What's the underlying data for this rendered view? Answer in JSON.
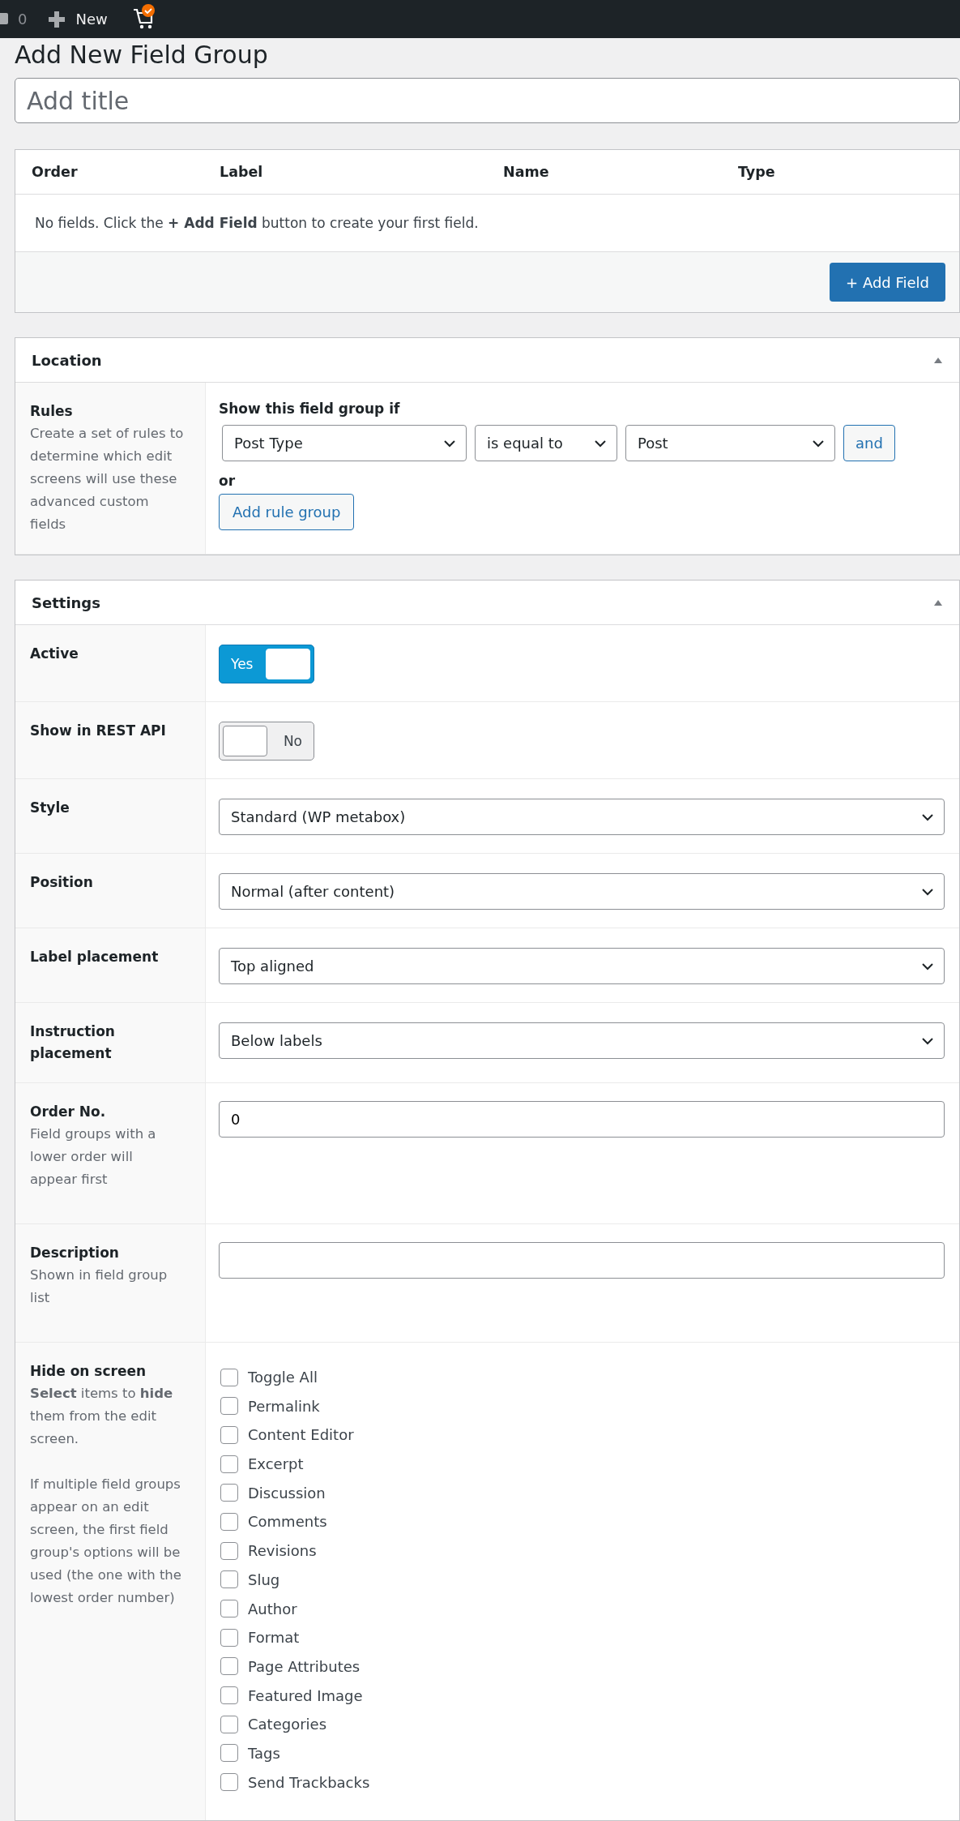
{
  "admin_bar": {
    "comments_count": "0",
    "new_label": "New"
  },
  "page_title": "Add New Field Group",
  "title_field": {
    "placeholder": "Add title"
  },
  "fields_table": {
    "columns": [
      "Order",
      "Label",
      "Name",
      "Type"
    ],
    "empty_message": "No fields. Click the **+ Add Field** button to create your first field.",
    "add_button": "+ Add Field"
  },
  "location": {
    "title": "Location",
    "label": "Rules",
    "description": "Create a set of rules to determine which edit screens will use these advanced custom fields",
    "heading": "Show this field group if",
    "rule": {
      "param": "Post Type",
      "operator": "is equal to",
      "value": "Post",
      "and_button": "and"
    },
    "or_label": "or",
    "add_group_button": "Add rule group"
  },
  "settings": {
    "title": "Settings",
    "rows": [
      {
        "kind": "toggle",
        "label": "Active",
        "on": true,
        "text": "Yes"
      },
      {
        "kind": "toggle",
        "label": "Show in REST API",
        "on": false,
        "text": "No"
      },
      {
        "kind": "select",
        "label": "Style",
        "value": "Standard (WP metabox)"
      },
      {
        "kind": "select",
        "label": "Position",
        "value": "Normal (after content)"
      },
      {
        "kind": "select",
        "label": "Label placement",
        "value": "Top aligned"
      },
      {
        "kind": "select",
        "label": "Instruction placement",
        "value": "Below labels"
      },
      {
        "kind": "input",
        "label": "Order No.",
        "description": "Field groups with a lower order will appear first",
        "value": "0"
      },
      {
        "kind": "input",
        "label": "Description",
        "description": "Shown in field group list",
        "value": ""
      },
      {
        "kind": "checklist",
        "label": "Hide on screen",
        "description": "**Select** items to **hide** them from the edit screen.",
        "note": "If multiple field groups appear on an edit screen, the first field group's options will be used (the one with the lowest order number)",
        "items": [
          {
            "label": "Toggle All",
            "checked": false
          },
          {
            "label": "Permalink",
            "checked": false
          },
          {
            "label": "Content Editor",
            "checked": false
          },
          {
            "label": "Excerpt",
            "checked": false
          },
          {
            "label": "Discussion",
            "checked": false
          },
          {
            "label": "Comments",
            "checked": false
          },
          {
            "label": "Revisions",
            "checked": false
          },
          {
            "label": "Slug",
            "checked": false
          },
          {
            "label": "Author",
            "checked": false
          },
          {
            "label": "Format",
            "checked": false
          },
          {
            "label": "Page Attributes",
            "checked": false
          },
          {
            "label": "Featured Image",
            "checked": false
          },
          {
            "label": "Categories",
            "checked": false
          },
          {
            "label": "Tags",
            "checked": false
          },
          {
            "label": "Send Trackbacks",
            "checked": false
          }
        ]
      }
    ]
  }
}
